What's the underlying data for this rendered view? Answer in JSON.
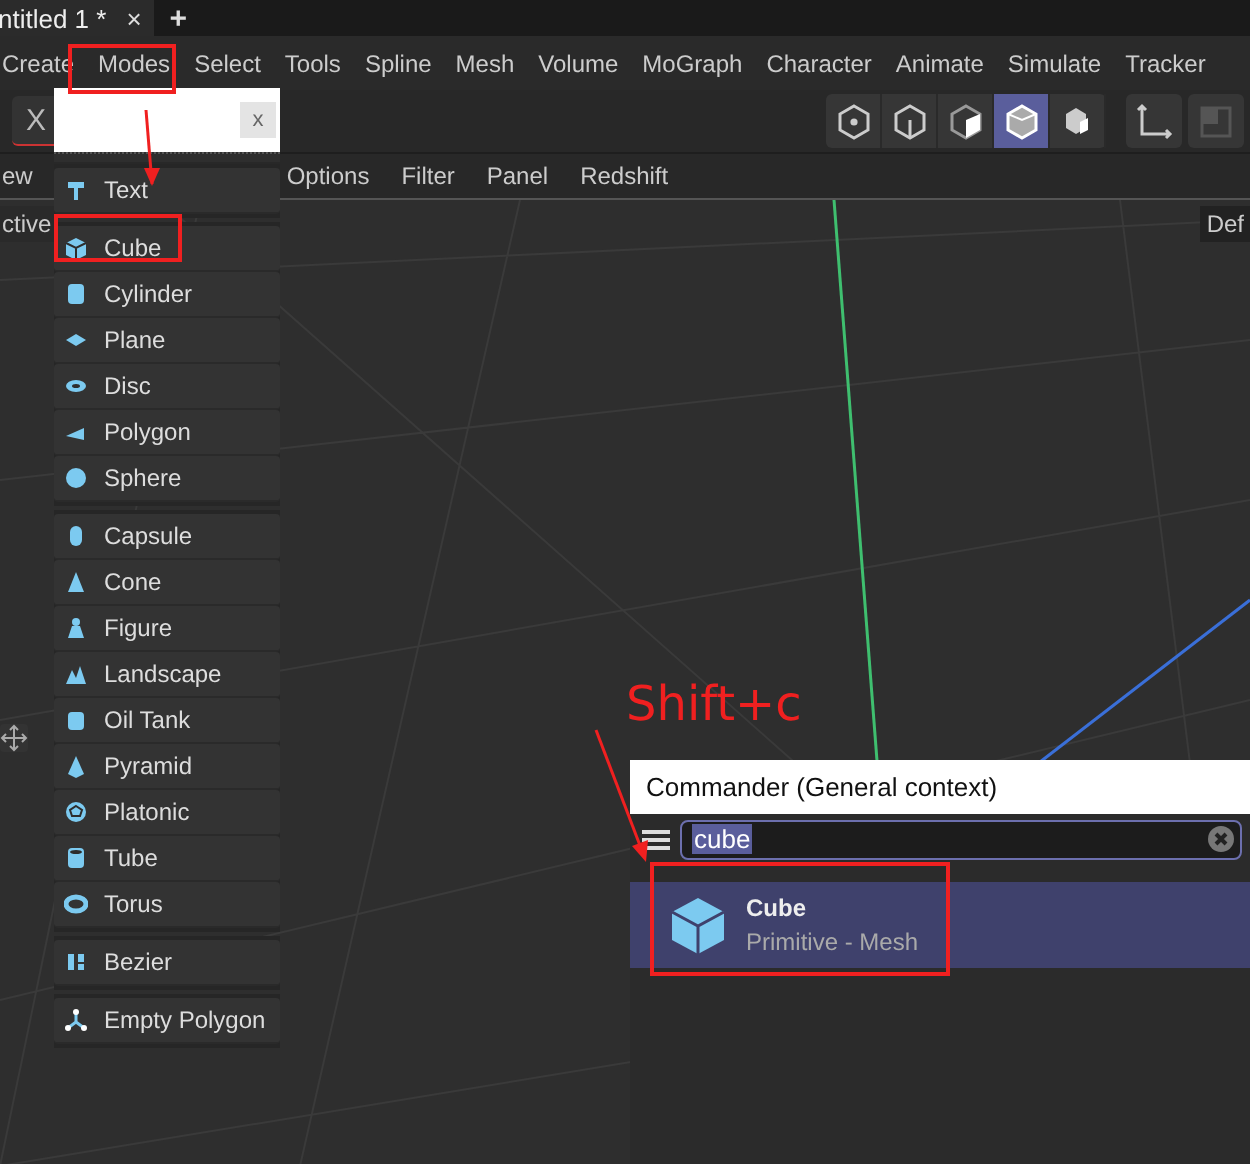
{
  "tabs": [
    {
      "label": "ntitled 1 *"
    }
  ],
  "tab_close": "×",
  "tab_add": "+",
  "menu_bar": [
    {
      "label": "Create"
    },
    {
      "label": "Modes"
    },
    {
      "label": "Select"
    },
    {
      "label": "Tools"
    },
    {
      "label": "Spline"
    },
    {
      "label": "Mesh"
    },
    {
      "label": "Volume"
    },
    {
      "label": "MoGraph"
    },
    {
      "label": "Character"
    },
    {
      "label": "Animate"
    },
    {
      "label": "Simulate"
    },
    {
      "label": "Tracker"
    }
  ],
  "toolbar": {
    "x_button": "X",
    "mode_buttons": [
      {
        "selected": false
      },
      {
        "selected": false
      },
      {
        "selected": false
      },
      {
        "selected": true
      },
      {
        "selected": false
      }
    ]
  },
  "viewport_menu": [
    "ew",
    "Options",
    "Filter",
    "Panel",
    "Redshift"
  ],
  "viewport": {
    "left_label": "ctive",
    "right_label": "Def"
  },
  "create_menu": {
    "clear": "x",
    "groups": [
      [
        {
          "label": "Text"
        }
      ],
      [
        {
          "label": "Cube"
        },
        {
          "label": "Cylinder"
        },
        {
          "label": "Plane"
        },
        {
          "label": "Disc"
        },
        {
          "label": "Polygon"
        },
        {
          "label": "Sphere"
        }
      ],
      [
        {
          "label": "Capsule"
        },
        {
          "label": "Cone"
        },
        {
          "label": "Figure"
        },
        {
          "label": "Landscape"
        },
        {
          "label": "Oil Tank"
        },
        {
          "label": "Pyramid"
        },
        {
          "label": "Platonic"
        },
        {
          "label": "Tube"
        },
        {
          "label": "Torus"
        }
      ],
      [
        {
          "label": "Bezier"
        }
      ],
      [
        {
          "label": "Empty Polygon"
        }
      ]
    ]
  },
  "commander": {
    "title": "Commander (General context)",
    "search_value": "cube",
    "results": [
      {
        "title": "Cube",
        "subtitle": "Primitive - Mesh",
        "selected": true
      }
    ]
  },
  "annotation": {
    "text": "Shift+c"
  }
}
